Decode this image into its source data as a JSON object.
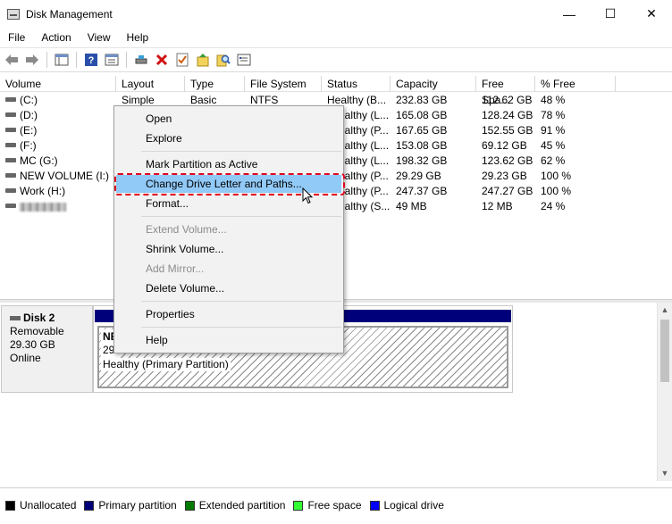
{
  "window": {
    "title": "Disk Management",
    "minimize_glyph": "—",
    "maximize_glyph": "☐",
    "close_glyph": "✕"
  },
  "menu": [
    "File",
    "Action",
    "View",
    "Help"
  ],
  "toolbar_icons": [
    "back-arrow-icon",
    "forward-arrow-icon",
    "console-tree-icon",
    "help-icon",
    "properties-icon",
    "connect-drive-icon",
    "delete-icon",
    "check-icon",
    "import-icon",
    "search-icon",
    "settings-icon"
  ],
  "columns": [
    "Volume",
    "Layout",
    "Type",
    "File System",
    "Status",
    "Capacity",
    "Free Spa...",
    "% Free"
  ],
  "volumes": [
    {
      "name": "(C:)",
      "layout": "Simple",
      "type": "Basic",
      "fs": "NTFS",
      "status": "Healthy (B...",
      "capacity": "232.83 GB",
      "free": "112.62 GB",
      "pct": "48 %"
    },
    {
      "name": "(D:)",
      "layout": "",
      "type": "",
      "fs": "",
      "status": "ealthy (L...",
      "capacity": "165.08 GB",
      "free": "128.24 GB",
      "pct": "78 %"
    },
    {
      "name": "(E:)",
      "layout": "",
      "type": "",
      "fs": "",
      "status": "ealthy (P...",
      "capacity": "167.65 GB",
      "free": "152.55 GB",
      "pct": "91 %"
    },
    {
      "name": "(F:)",
      "layout": "",
      "type": "",
      "fs": "",
      "status": "ealthy (L...",
      "capacity": "153.08 GB",
      "free": "69.12 GB",
      "pct": "45 %"
    },
    {
      "name": "MC (G:)",
      "layout": "",
      "type": "",
      "fs": "",
      "status": "ealthy (L...",
      "capacity": "198.32 GB",
      "free": "123.62 GB",
      "pct": "62 %"
    },
    {
      "name": "NEW VOLUME (I:)",
      "layout": "",
      "type": "",
      "fs": "",
      "status": "ealthy (P...",
      "capacity": "29.29 GB",
      "free": "29.23 GB",
      "pct": "100 %"
    },
    {
      "name": "Work (H:)",
      "layout": "",
      "type": "",
      "fs": "",
      "status": "ealthy (P...",
      "capacity": "247.37 GB",
      "free": "247.27 GB",
      "pct": "100 %"
    },
    {
      "name": "",
      "layout": "",
      "type": "",
      "fs": "",
      "status": "ealthy (S...",
      "capacity": "49 MB",
      "free": "12 MB",
      "pct": "24 %"
    }
  ],
  "context_menu": {
    "open": "Open",
    "explore": "Explore",
    "mark_active": "Mark Partition as Active",
    "change_letter": "Change Drive Letter and Paths...",
    "format": "Format...",
    "extend": "Extend Volume...",
    "shrink": "Shrink Volume...",
    "add_mirror": "Add Mirror...",
    "delete": "Delete Volume...",
    "properties": "Properties",
    "help": "Help"
  },
  "disk": {
    "name": "Disk 2",
    "kind": "Removable",
    "size": "29.30 GB",
    "state": "Online"
  },
  "partition": {
    "name_fragment": "NE",
    "size_fragment": "29.",
    "status": "Healthy (Primary Partition)"
  },
  "legend": [
    {
      "label": "Unallocated",
      "color": "#000000"
    },
    {
      "label": "Primary partition",
      "color": "#00007a"
    },
    {
      "label": "Extended partition",
      "color": "#007a00"
    },
    {
      "label": "Free space",
      "color": "#33ff33"
    },
    {
      "label": "Logical drive",
      "color": "#0000ff"
    }
  ],
  "colors": {
    "menu_highlight": "#91c9f7",
    "annotation": "#e0001b",
    "primary_partition": "#00007a"
  }
}
